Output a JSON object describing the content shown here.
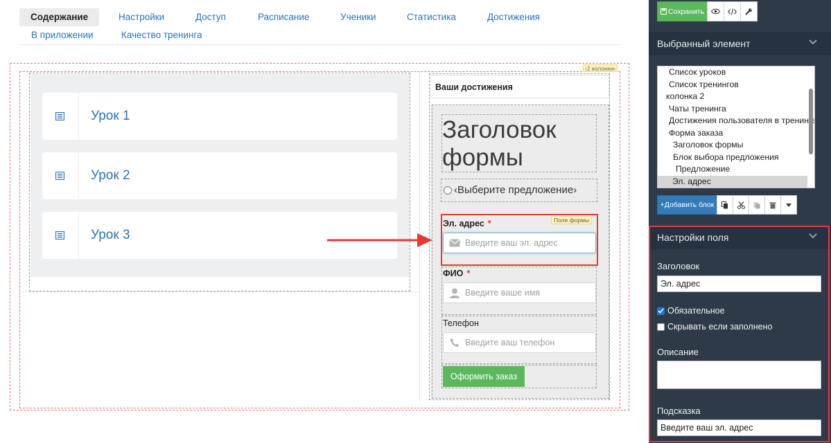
{
  "tabs": [
    {
      "label": "Содержание",
      "active": true
    },
    {
      "label": "Настройки"
    },
    {
      "label": "Доступ"
    },
    {
      "label": "Расписание"
    },
    {
      "label": "Ученики"
    },
    {
      "label": "Статистика"
    },
    {
      "label": "Достижения"
    },
    {
      "label": "В приложении"
    },
    {
      "label": "Качество тренинга"
    }
  ],
  "canvas": {
    "columns_badge": "‹2 колонки›",
    "lessons": [
      {
        "title": "Урок 1",
        "icon": "list-icon"
      },
      {
        "title": "Урок 2",
        "icon": "list-icon"
      },
      {
        "title": "Урок 3",
        "icon": "list-icon"
      }
    ],
    "achievements_title": "Ваши достижения",
    "form": {
      "title": "Заголовок формы",
      "offer_placeholder": "‹Выберите предложение›",
      "field_badge": "Поле формы",
      "fields": [
        {
          "label": "Эл. адрес",
          "required": true,
          "placeholder": "Введите ваш эл. адрес",
          "icon": "envelope-icon"
        },
        {
          "label": "ФИО",
          "required": true,
          "placeholder": "Введите ваше имя",
          "icon": "user-icon"
        },
        {
          "label": "Телефон",
          "required": false,
          "placeholder": "Введите ваш телефон",
          "icon": "phone-icon"
        }
      ],
      "submit_label": "Оформить заказ"
    }
  },
  "sidebar": {
    "toolbar": {
      "save_label": "Сохранить",
      "icons": [
        "eye-icon",
        "code-icon",
        "wrench-icon"
      ]
    },
    "selected_element": {
      "title": "Выбранный элемент",
      "tree": [
        {
          "label": "Список уроков",
          "level": 1
        },
        {
          "label": "Список тренингов",
          "level": 1
        },
        {
          "label": "колонка 2",
          "level": 0
        },
        {
          "label": "Чаты тренинга",
          "level": 1
        },
        {
          "label": "Достижения пользователя в тренинге",
          "level": 1
        },
        {
          "label": "Форма заказа",
          "level": 1
        },
        {
          "label": "Заголовок формы",
          "level": 2
        },
        {
          "label": "Блок выбора предложения",
          "level": 2
        },
        {
          "label": "Предложение",
          "level": 3
        },
        {
          "label": "Эл. адрес",
          "level": 2,
          "selected": true
        }
      ],
      "add_block_label": "+Добавить блок",
      "action_icons": [
        "copy-icon",
        "scissors-icon",
        "paste-icon",
        "trash-icon",
        "caret-down-icon"
      ]
    },
    "field_settings": {
      "title": "Настройки поля",
      "heading_label": "Заголовок",
      "heading_value": "Эл. адрес",
      "required_label": "Обязательное",
      "required_checked": true,
      "hide_if_filled_label": "Скрывать если заполнено",
      "hide_if_filled_checked": false,
      "description_label": "Описание",
      "description_value": "",
      "hint_label": "Подсказка",
      "hint_value": "Введите ваш эл. адрес"
    }
  },
  "colors": {
    "link_blue": "#2a73b8",
    "sidebar_bg": "#2e3a47",
    "sidebar_header_bg": "#263240",
    "save_green": "#5cb85c",
    "add_blue": "#337ab7",
    "highlight_red": "#e53935"
  }
}
